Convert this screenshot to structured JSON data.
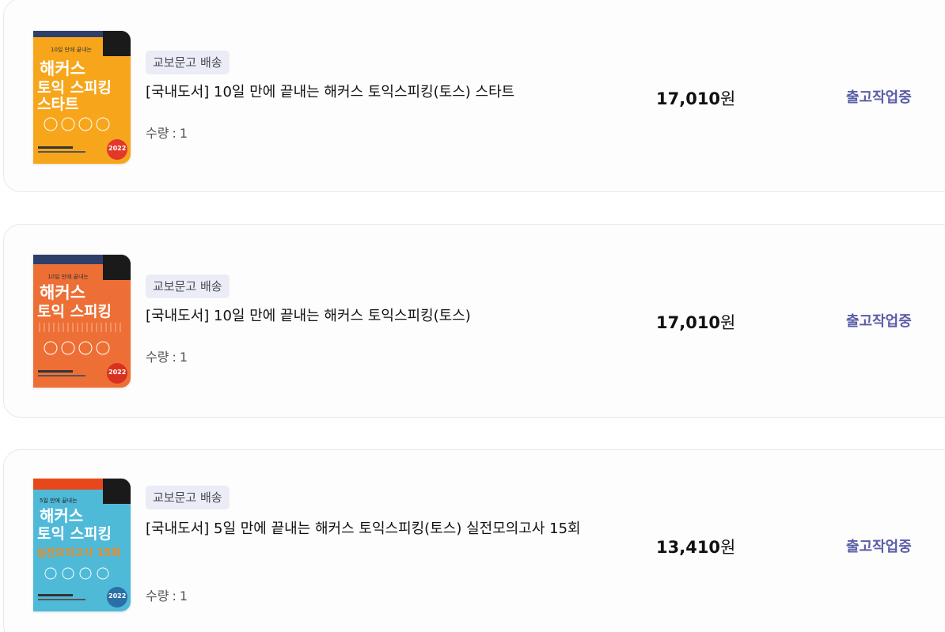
{
  "orders": [
    {
      "badge": "교보문고 배송",
      "title": "[국내도서] 10일 만에 끝내는 해커스 토익스피킹(토스) 스타트",
      "qty_label": "수량",
      "qty_sep": ":",
      "qty_value": "1",
      "price_number": "17,010",
      "price_unit": "원",
      "status": "출고작업중",
      "cover": {
        "bg_color": "#f7a61c",
        "accent_color": "#ffffff",
        "tagline": "10일 만에 끝내는",
        "brand": "해커스",
        "line1": "토익 스피킹",
        "line2": "스타트",
        "year": "2022"
      }
    },
    {
      "badge": "교보문고 배송",
      "title": "[국내도서] 10일 만에 끝내는 해커스 토익스피킹(토스)",
      "qty_label": "수량",
      "qty_sep": ":",
      "qty_value": "1",
      "price_number": "17,010",
      "price_unit": "원",
      "status": "출고작업중",
      "cover": {
        "bg_color": "#ee6f35",
        "accent_color": "#ffffff",
        "tagline": "10일 만에 끝내는",
        "brand": "해커스",
        "line1": "토익 스피킹",
        "line2": "",
        "year": "2022"
      }
    },
    {
      "badge": "교보문고 배송",
      "title": "[국내도서] 5일 만에 끝내는 해커스 토익스피킹(토스) 실전모의고사 15회",
      "qty_label": "수량",
      "qty_sep": ":",
      "qty_value": "1",
      "price_number": "13,410",
      "price_unit": "원",
      "status": "출고작업중",
      "cover": {
        "bg_color": "#4fb9d8",
        "accent_color": "#f28a1d",
        "tagline": "5일 만에 끝내는",
        "brand": "해커스",
        "line1": "토익 스피킹",
        "line2": "실전모의고사 15회",
        "year": "2022"
      }
    }
  ]
}
